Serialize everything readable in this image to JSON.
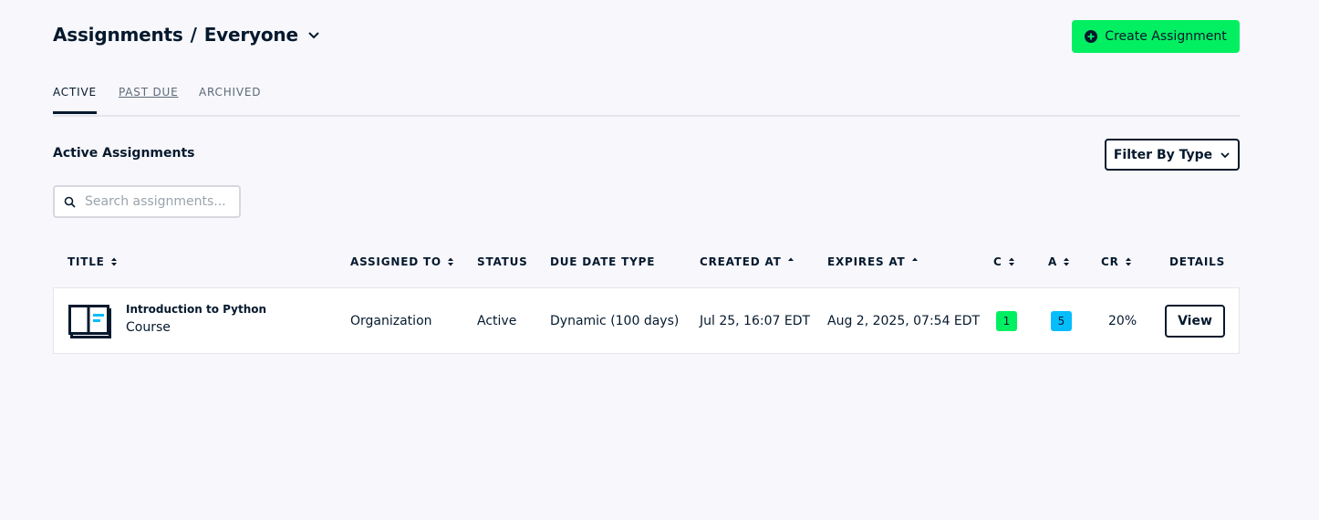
{
  "header": {
    "title": "Assignments",
    "separator": "/",
    "scope": "Everyone",
    "create_button_label": "Create Assignment"
  },
  "tabs": [
    {
      "label": "ACTIVE",
      "active": true
    },
    {
      "label": "PAST DUE",
      "active": false
    },
    {
      "label": "ARCHIVED",
      "active": false
    }
  ],
  "section": {
    "title": "Active Assignments",
    "filter_label": "Filter By Type"
  },
  "search": {
    "placeholder": "Search assignments...",
    "value": ""
  },
  "table": {
    "columns": {
      "title": "TITLE",
      "assigned_to": "ASSIGNED TO",
      "status": "STATUS",
      "due_date_type": "DUE DATE TYPE",
      "created_at": "CREATED AT",
      "expires_at": "EXPIRES AT",
      "c": "C",
      "a": "A",
      "cr": "CR",
      "details": "DETAILS"
    },
    "rows": [
      {
        "name": "Introduction to Python",
        "type": "Course",
        "assigned_to": "Organization",
        "status": "Active",
        "due_date_type": "Dynamic (100 days)",
        "created_at": "Jul 25, 16:07 EDT",
        "expires_at": "Aug 2, 2025, 07:54 EDT",
        "c": "1",
        "a": "5",
        "cr": "20%",
        "details_label": "View"
      }
    ]
  },
  "colors": {
    "brand_green": "#03ef62",
    "badge_blue": "#06bdfc",
    "navy": "#05192d"
  },
  "icons": [
    "chevron-down-icon",
    "plus-circle-icon",
    "search-icon",
    "sort-icon",
    "sort-up-icon",
    "course-icon"
  ]
}
